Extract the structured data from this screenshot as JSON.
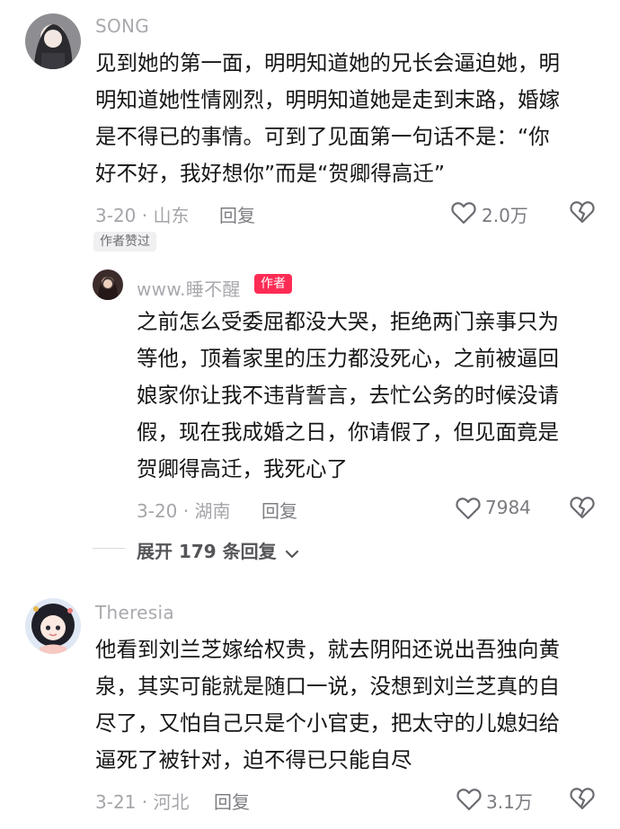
{
  "comments": [
    {
      "user": "SONG",
      "text": "见到她的第一面，明明知道她的兄长会逼迫她，明明知道她性情刚烈，明明知道她是走到末路，婚嫁是不得已的事情。可到了见面第一句话不是：“你好不好，我好想你”而是“贺卿得高迁”",
      "lines": [
        "见到她的第一面，明明知道她的兄长会逼迫她，明",
        "明知道她性情刚烈，明明知道她是走到末路，婚嫁",
        "是不得已的事情。可到了见面第一句话不是：“你",
        "好不好，我好想你”而是“贺卿得高迁”"
      ],
      "date_location": "3-20 · 山东",
      "reply_label": "回复",
      "likes": "2.0万",
      "badge": "作者赞过"
    },
    {
      "user": "www.睡不醒",
      "author_badge": "作者",
      "text": "之前怎么受委屈都没大哭，拒绝两门亲事只为等他，顶着家里的压力都没死心，之前被逼回娘家你让我不违背誓言，去忙公务的时候没请假，现在我成婚之日，你请假了，但见面竟是贺卿得高迁，我死心了",
      "lines": [
        "之前怎么受委屈都没大哭，拒绝两门亲事只为",
        "等他，顶着家里的压力都没死心，之前被逼回",
        "娘家你让我不违背誓言，去忙公务的时候没请",
        "假，现在我成婚之日，你请假了，但见面竟是",
        "贺卿得高迁，我死心了"
      ],
      "date_location": "3-20 · 湖南",
      "reply_label": "回复",
      "likes": "7984"
    },
    {
      "user": "Theresia",
      "text": "他看到刘兰芝嫁给权贵，就去阴阳还说出吾独向黄泉，其实可能就是随口一说，没想到刘兰芝真的自尽了，又怕自己只是个小官吏，把太守的儿媳妇给逼死了被针对，迫不得已只能自尽",
      "lines": [
        "他看到刘兰芝嫁给权贵，就去阴阳还说出吾独向黄",
        "泉，其实可能就是随口一说，没想到刘兰芝真的自",
        "尽了，又怕自己只是个小官吏，把太守的儿媳妇给",
        "逼死了被针对，迫不得已只能自尽"
      ],
      "date_location": "3-21 · 河北",
      "reply_label": "回复",
      "likes": "3.1万"
    }
  ],
  "expand_replies": "展开 179 条回复",
  "colors": {
    "author_badge": "#fe2c55",
    "muted": "#a5a5aa"
  },
  "icons": [
    "heart-outline-icon",
    "broken-heart-icon",
    "chevron-down-icon"
  ]
}
